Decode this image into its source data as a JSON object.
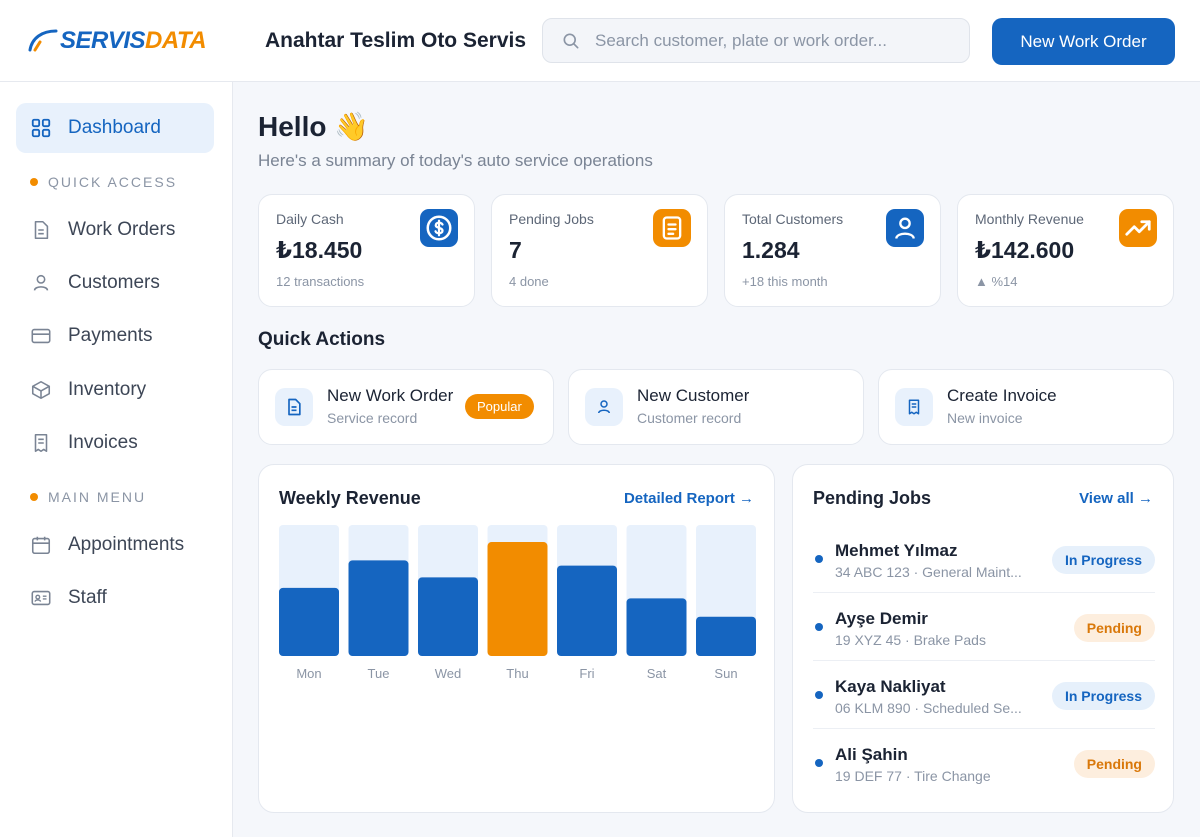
{
  "header": {
    "logo": {
      "part1": "SERVIS",
      "part2": "DATA"
    },
    "business_name": "Anahtar Teslim Oto Servis",
    "search_placeholder": "Search customer, plate or work order...",
    "new_work_order": "New Work Order"
  },
  "sidebar": {
    "dashboard": "Dashboard",
    "quick_access_label": "QUICK ACCESS",
    "quick_access_items": [
      {
        "label": "Work Orders",
        "icon": "document-icon"
      },
      {
        "label": "Customers",
        "icon": "user-icon"
      },
      {
        "label": "Payments",
        "icon": "credit-card-icon"
      },
      {
        "label": "Inventory",
        "icon": "box-icon"
      },
      {
        "label": "Invoices",
        "icon": "receipt-icon"
      }
    ],
    "main_menu_label": "MAIN MENU",
    "main_menu_items": [
      {
        "label": "Appointments",
        "icon": "calendar-icon"
      },
      {
        "label": "Staff",
        "icon": "id-card-icon"
      }
    ]
  },
  "greeting": {
    "title": "Hello 👋",
    "subtitle": "Here's a summary of today's auto service operations"
  },
  "stats": [
    {
      "label": "Daily Cash",
      "value": "₺18.450",
      "note": "12 transactions",
      "icon": "dollar-circle-icon",
      "color": "#1565c0"
    },
    {
      "label": "Pending Jobs",
      "value": "7",
      "note": "4 done",
      "icon": "clipboard-icon",
      "color": "#f28c00"
    },
    {
      "label": "Total Customers",
      "value": "1.284",
      "note": "+18 this month",
      "icon": "user-icon",
      "color": "#1565c0"
    },
    {
      "label": "Monthly Revenue",
      "value": "₺142.600",
      "note": "▲ %14",
      "icon": "trend-up-icon",
      "color": "#f28c00"
    }
  ],
  "quick_actions": {
    "title": "Quick Actions",
    "items": [
      {
        "label": "New Work Order",
        "sub": "Service record",
        "badge": "Popular"
      },
      {
        "label": "New Customer",
        "sub": "Customer record"
      },
      {
        "label": "Create Invoice",
        "sub": "New invoice"
      }
    ]
  },
  "weekly_revenue": {
    "title": "Weekly Revenue",
    "link": "Detailed Report →"
  },
  "chart_data": {
    "type": "bar",
    "title": "Weekly Revenue",
    "categories": [
      "Mon",
      "Tue",
      "Wed",
      "Thu",
      "Fri",
      "Sat",
      "Sun"
    ],
    "values": [
      52,
      73,
      60,
      87,
      69,
      44,
      30
    ],
    "ylim": [
      0,
      100
    ],
    "highlight_index": 3,
    "colors": {
      "bar": "#1565c0",
      "highlight": "#f28c00",
      "track": "#e8f1fc"
    }
  },
  "pending_jobs": {
    "title": "Pending Jobs",
    "link": "View all →",
    "items": [
      {
        "name": "Mehmet Yılmaz",
        "detail": "34 ABC 123 · General Maint...",
        "status": "In Progress",
        "kind": "progress"
      },
      {
        "name": "Ayşe Demir",
        "detail": "19 XYZ 45 · Brake Pads",
        "status": "Pending",
        "kind": "pending"
      },
      {
        "name": "Kaya Nakliyat",
        "detail": "06 KLM 890 · Scheduled Se...",
        "status": "In Progress",
        "kind": "progress"
      },
      {
        "name": "Ali Şahin",
        "detail": "19 DEF 77 · Tire Change",
        "status": "Pending",
        "kind": "pending"
      }
    ]
  }
}
